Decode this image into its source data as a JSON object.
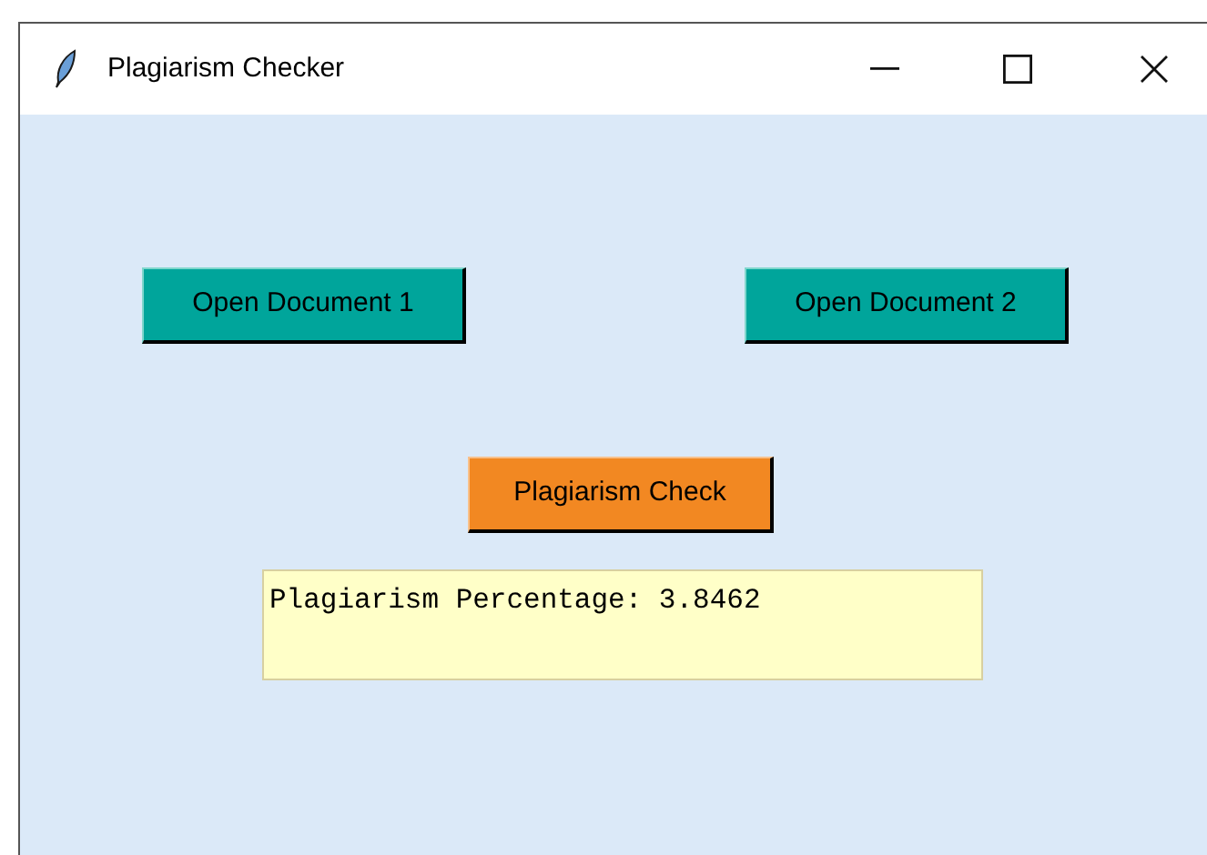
{
  "window": {
    "title": "Plagiarism Checker"
  },
  "open_buttons": [
    {
      "label": "Open Document 1"
    },
    {
      "label": "Open Document 2"
    }
  ],
  "check_button": {
    "label": "Plagiarism Check"
  },
  "result_box": {
    "value": "Plagiarism Percentage: 3.8462"
  }
}
